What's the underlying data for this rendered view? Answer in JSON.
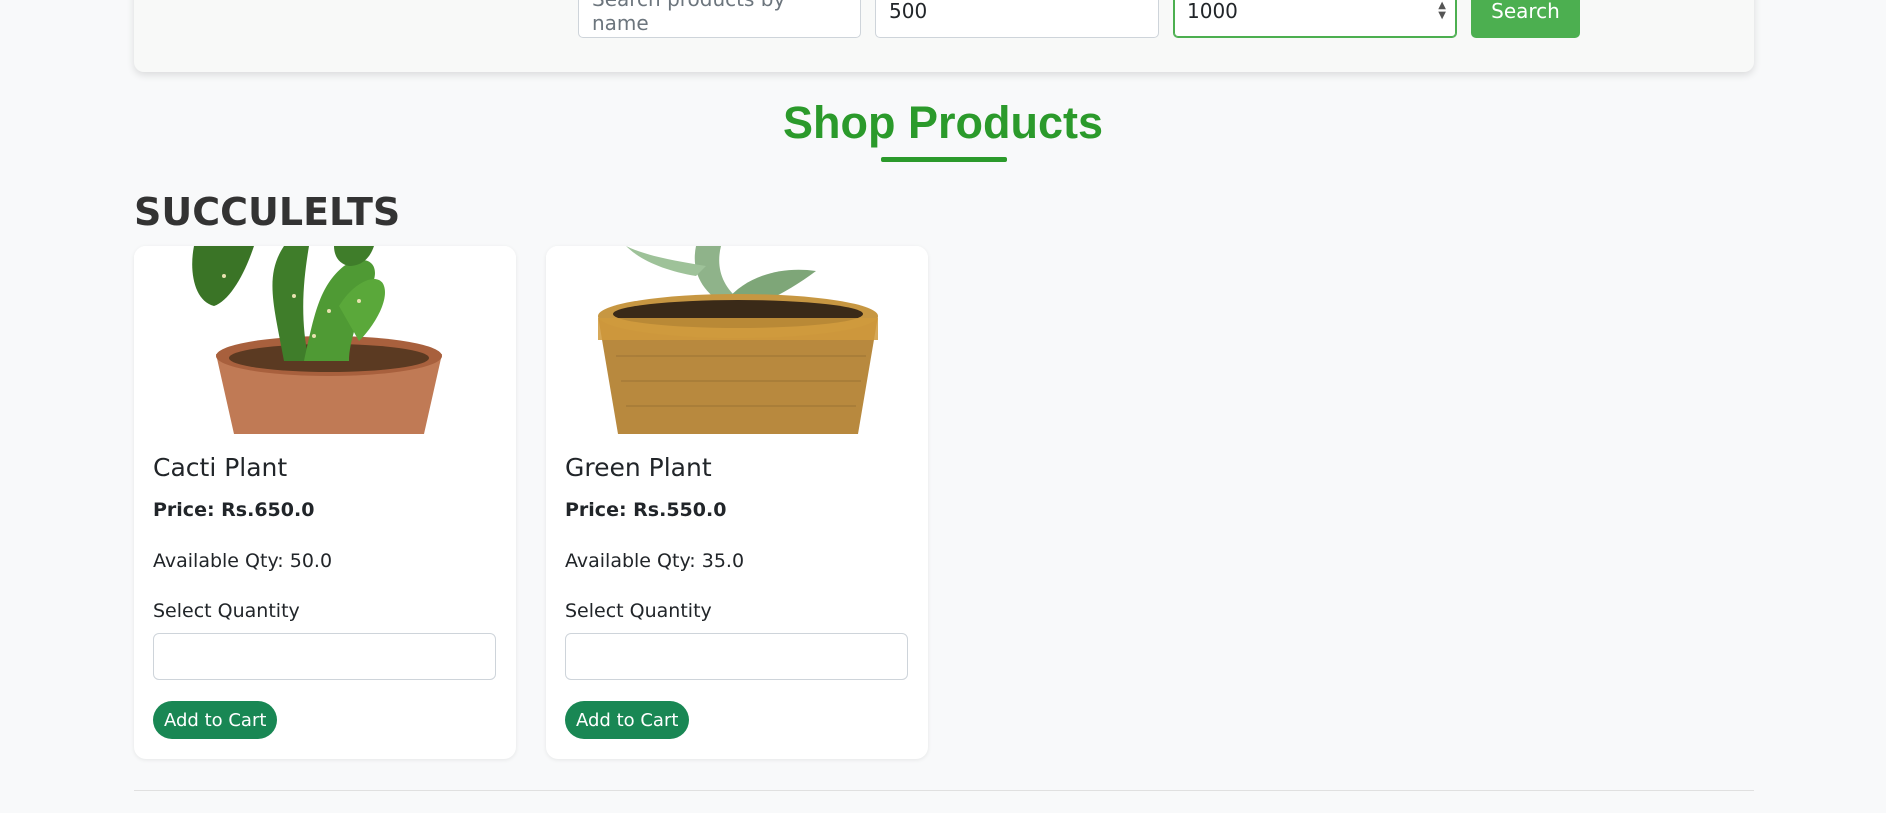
{
  "search": {
    "name_placeholder": "Search products by name",
    "min_price": "500",
    "max_price": "1000",
    "button_label": "Search"
  },
  "heading": "Shop Products",
  "category": "SUCCULELTS",
  "products": [
    {
      "name": "Cacti Plant",
      "price": "Price: Rs.650.0",
      "qty": "Available Qty: 50.0",
      "select_label": "Select Quantity",
      "button_label": "Add to Cart"
    },
    {
      "name": "Green Plant",
      "price": "Price: Rs.550.0",
      "qty": "Available Qty: 35.0",
      "select_label": "Select Quantity",
      "button_label": "Add to Cart"
    }
  ],
  "colors": {
    "accent": "#4caf50",
    "heading": "#2b9a2b",
    "cart_button": "#198754"
  }
}
